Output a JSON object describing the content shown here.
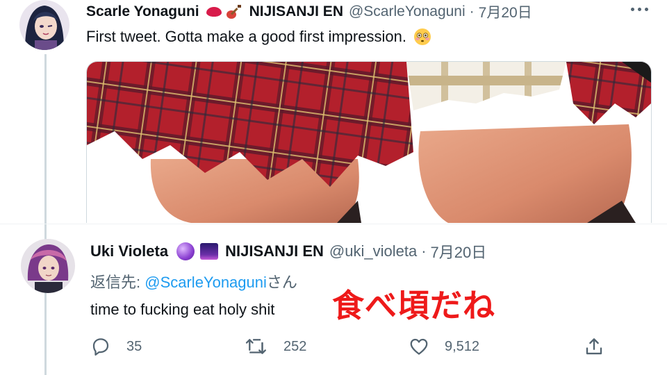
{
  "tweet1": {
    "author_name": "Scarle Yonaguni",
    "org": "NIJISANJI EN",
    "handle": "@ScarleYonaguni",
    "separator": "·",
    "date": "7月20日",
    "text": "First tweet. Gotta make a good first impression.",
    "icons": [
      "kiss-mark-emoji",
      "guitar-emoji",
      "flushed-face-emoji",
      "more-options-icon"
    ]
  },
  "tweet2": {
    "author_name": "Uki Violeta",
    "org": "NIJISANJI EN",
    "handle": "@uki_violeta",
    "separator": "·",
    "date": "7月20日",
    "reply_prefix": "返信先: ",
    "reply_mention": "@ScarleYonaguni",
    "reply_suffix": "さん",
    "text": "time to fucking eat holy shit",
    "icons": [
      "crystal-ball-emoji",
      "night-sky-emoji"
    ]
  },
  "overlay_caption": "食べ頃だね",
  "actions": {
    "reply_count": "35",
    "retweet_count": "252",
    "like_count": "9,512"
  },
  "colors": {
    "link": "#1d9bf0",
    "secondary_text": "#536471",
    "caption_red": "#ee1a1a",
    "plaid_red": "#b3202c"
  }
}
